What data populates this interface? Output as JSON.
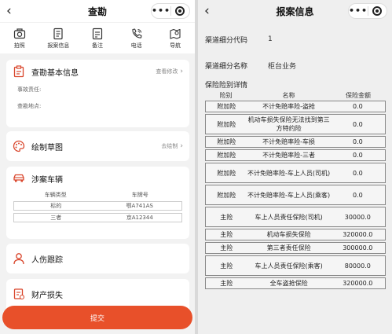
{
  "left": {
    "nav": {
      "back": "‹",
      "title": "查勘",
      "dots": "•••"
    },
    "toolbar": [
      {
        "label": "拍照",
        "icon": "camera-icon"
      },
      {
        "label": "报案信息",
        "icon": "document-icon"
      },
      {
        "label": "备注",
        "icon": "note-icon"
      },
      {
        "label": "电话",
        "icon": "phone-icon"
      },
      {
        "label": "导航",
        "icon": "navigation-icon"
      }
    ],
    "basic": {
      "title": "查勘基本信息",
      "link": "查看修改",
      "fields": [
        "事故责任:",
        "查勘地点:"
      ]
    },
    "sketch": {
      "title": "绘制草图",
      "link": "去绘制"
    },
    "vehicles": {
      "title": "涉案车辆",
      "headers": [
        "车辆类型",
        "车牌号"
      ],
      "rows": [
        {
          "type": "标的",
          "plate": "鄂A741AS"
        },
        {
          "type": "三者",
          "plate": "京A12344"
        }
      ]
    },
    "injury": {
      "title": "人伤跟踪"
    },
    "property": {
      "title": "财产损失"
    },
    "submit": "提交"
  },
  "right": {
    "nav": {
      "back": "‹",
      "title": "报案信息",
      "dots": "•••"
    },
    "channel_code": {
      "label": "渠道细分代码",
      "value": "1"
    },
    "channel_name": {
      "label": "渠道细分名称",
      "value": "柜台业务"
    },
    "detail_title": "保险险别详情",
    "headers": {
      "type": "险别",
      "name": "名称",
      "amount": "保险金额"
    },
    "rows": [
      {
        "type": "附加险",
        "name": "不计免赔率险-盗抢",
        "amount": "0.0"
      },
      {
        "type": "附加险",
        "name": "机动车损失保险无法找到第三方特约险",
        "amount": "0.0"
      },
      {
        "type": "附加险",
        "name": "不计免赔率险-车损",
        "amount": "0.0"
      },
      {
        "type": "附加险",
        "name": "不计免赔率险-三者",
        "amount": "0.0"
      },
      {
        "type": "附加险",
        "name": "不计免赔率险-车上人员(司机)",
        "amount": "0.0"
      },
      {
        "type": "附加险",
        "name": "不计免赔率险-车上人员(乘客)",
        "amount": "0.0"
      },
      {
        "type": "主险",
        "name": "车上人员责任保险(司机)",
        "amount": "30000.0"
      },
      {
        "type": "主险",
        "name": "机动车损失保险",
        "amount": "320000.0"
      },
      {
        "type": "主险",
        "name": "第三者责任保险",
        "amount": "300000.0"
      },
      {
        "type": "主险",
        "name": "车上人员责任保险(乘客)",
        "amount": "80000.0"
      },
      {
        "type": "主险",
        "name": "全车盗抢保险",
        "amount": "320000.0"
      }
    ]
  },
  "colors": {
    "accent": "#e8502a",
    "icon_red": "#d9452b"
  }
}
